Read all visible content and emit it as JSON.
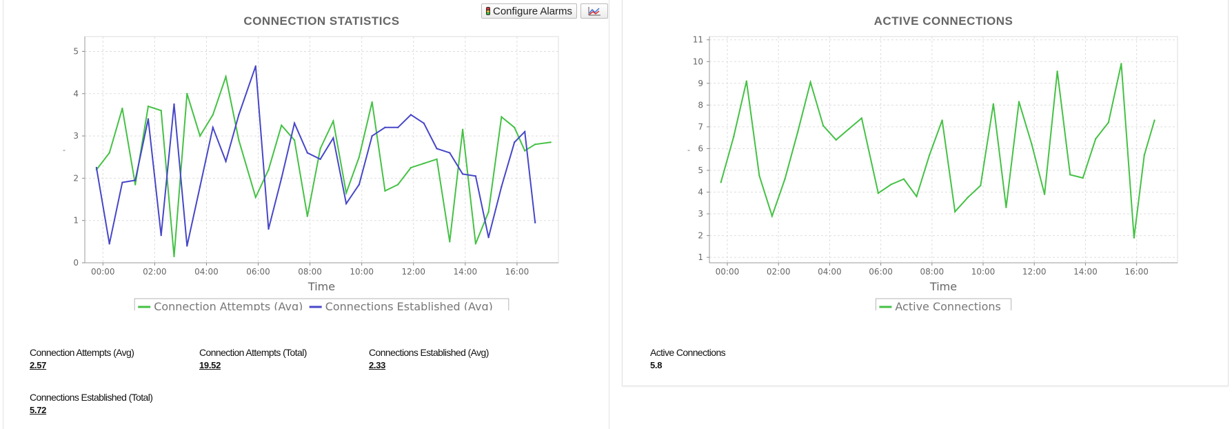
{
  "toolbar": {
    "configure_alarms_label": "Configure Alarms",
    "configure_alarms_icon": "traffic-light-icon",
    "chart_type_icon": "line-chart-icon"
  },
  "colors": {
    "green": "#44c144",
    "blue": "#4646c8",
    "grid": "#dddddd",
    "title": "#666666",
    "axis_text": "#666666"
  },
  "chart_data": [
    {
      "type": "line",
      "title": "CONNECTION STATISTICS",
      "xlabel": "Time",
      "ylabel": "-",
      "x_ticks": [
        "00:00",
        "02:00",
        "04:00",
        "06:00",
        "08:00",
        "10:00",
        "12:00",
        "14:00",
        "16:00"
      ],
      "x_range_hours": [
        -0.7,
        17.6
      ],
      "ylim": [
        0,
        5.35
      ],
      "y_ticks": [
        0,
        1,
        2,
        3,
        4,
        5
      ],
      "grid": true,
      "legend_position": "bottom",
      "series": [
        {
          "name": "Connection Attempts (Avg)",
          "color": "#44c144",
          "x_hours": [
            -0.25,
            0.25,
            0.75,
            1.25,
            1.75,
            2.25,
            2.75,
            3.25,
            3.75,
            4.25,
            4.75,
            5.25,
            5.9,
            6.4,
            6.9,
            7.4,
            7.9,
            8.4,
            8.9,
            9.4,
            9.9,
            10.4,
            10.9,
            11.4,
            11.9,
            12.4,
            12.9,
            13.4,
            13.9,
            14.4,
            14.9,
            15.4,
            15.9,
            16.3,
            16.7,
            17.3
          ],
          "values": [
            2.2,
            2.6,
            3.65,
            1.85,
            3.7,
            3.6,
            0.15,
            4.0,
            3.0,
            3.5,
            4.4,
            2.9,
            1.55,
            2.2,
            3.25,
            2.9,
            1.1,
            2.7,
            3.35,
            1.65,
            2.5,
            3.8,
            1.7,
            1.85,
            2.25,
            2.35,
            2.45,
            0.5,
            3.15,
            0.45,
            1.2,
            3.45,
            3.2,
            2.65,
            2.8,
            2.85
          ]
        },
        {
          "name": "Connections Established (Avg)",
          "color": "#4646c8",
          "x_hours": [
            -0.25,
            0.25,
            0.75,
            1.25,
            1.75,
            2.25,
            2.75,
            3.25,
            3.75,
            4.25,
            4.75,
            5.25,
            5.9,
            6.4,
            6.9,
            7.4,
            7.9,
            8.4,
            8.9,
            9.4,
            9.9,
            10.4,
            10.9,
            11.4,
            11.9,
            12.4,
            12.9,
            13.4,
            13.9,
            14.4,
            14.9,
            15.4,
            15.9,
            16.3,
            16.7,
            17.3
          ],
          "values": [
            2.25,
            0.45,
            1.9,
            1.95,
            3.4,
            0.65,
            3.75,
            0.4,
            1.8,
            3.2,
            2.4,
            3.5,
            4.65,
            0.8,
            2.0,
            3.3,
            2.6,
            2.45,
            2.95,
            1.4,
            1.85,
            3.0,
            3.2,
            3.2,
            3.5,
            3.3,
            2.7,
            2.6,
            2.1,
            2.05,
            0.6,
            1.8,
            2.85,
            3.1,
            0.95
          ]
        }
      ]
    },
    {
      "type": "line",
      "title": "ACTIVE CONNECTIONS",
      "xlabel": "Time",
      "ylabel": "-",
      "x_ticks": [
        "00:00",
        "02:00",
        "04:00",
        "06:00",
        "08:00",
        "10:00",
        "12:00",
        "14:00",
        "16:00"
      ],
      "x_range_hours": [
        -0.7,
        17.6
      ],
      "ylim": [
        0.75,
        11.15
      ],
      "y_ticks": [
        1,
        2,
        3,
        4,
        5,
        6,
        7,
        8,
        9,
        10,
        11
      ],
      "grid": true,
      "legend_position": "bottom",
      "series": [
        {
          "name": "Active Connections",
          "color": "#44c144",
          "x_hours": [
            -0.25,
            0.25,
            0.75,
            1.25,
            1.75,
            2.25,
            2.75,
            3.25,
            3.75,
            4.25,
            4.75,
            5.25,
            5.9,
            6.4,
            6.9,
            7.4,
            7.9,
            8.4,
            8.9,
            9.4,
            9.9,
            10.4,
            10.9,
            11.4,
            11.9,
            12.4,
            12.9,
            13.4,
            13.9,
            14.4,
            14.9,
            15.4,
            15.9,
            16.3,
            16.7,
            17.3
          ],
          "values": [
            4.45,
            6.55,
            9.1,
            4.75,
            2.9,
            4.6,
            6.75,
            9.05,
            7.05,
            6.4,
            6.9,
            7.4,
            3.95,
            4.35,
            4.6,
            3.8,
            5.7,
            7.3,
            3.1,
            3.75,
            4.3,
            8.05,
            3.3,
            8.15,
            6.2,
            3.9,
            9.55,
            4.8,
            4.65,
            6.45,
            7.2,
            9.9,
            1.9,
            5.7,
            7.3
          ]
        }
      ]
    }
  ],
  "left_stats": [
    {
      "label": "Connection Attempts (Avg)",
      "value": "2.57"
    },
    {
      "label": "Connection Attempts (Total)",
      "value": "19.52"
    },
    {
      "label": "Connections Established (Avg)",
      "value": "2.33"
    },
    {
      "label": "Connections Established (Total)",
      "value": "5.72"
    }
  ],
  "right_stats": [
    {
      "label": "Active Connections",
      "value": "5.8"
    }
  ]
}
